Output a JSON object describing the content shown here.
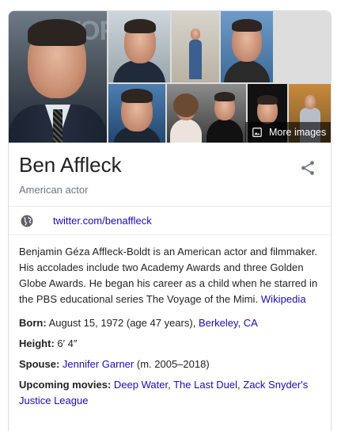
{
  "gallery": {
    "background_text": "TOR",
    "more_images_label": "More images",
    "more_images_icon": "image-icon"
  },
  "entity": {
    "name": "Ben Affleck",
    "subtitle": "American actor",
    "share_icon": "share-icon"
  },
  "website": {
    "icon": "globe-icon",
    "label": "twitter.com/benaffleck"
  },
  "description": {
    "text": "Benjamin Géza Affleck-Boldt is an American actor and filmmaker. His accolades include two Academy Awards and three Golden Globe Awards. He began his career as a child when he starred in the PBS educational series The Voyage of the Mimi.",
    "source_link": "Wikipedia"
  },
  "facts": {
    "born": {
      "label": "Born:",
      "value": "August 15, 1972 (age 47 years),",
      "link": "Berkeley, CA"
    },
    "height": {
      "label": "Height:",
      "value": "6′ 4″"
    },
    "spouse": {
      "label": "Spouse:",
      "link": "Jennifer Garner",
      "value": "(m. 2005–2018)"
    },
    "upcoming_movies": {
      "label": "Upcoming movies:",
      "link1": "Deep Water",
      "link2": "The Last Duel",
      "link3": "Zack Snyder's Justice League"
    }
  },
  "colors": {
    "link": "#1a0dab",
    "text": "#222222",
    "muted": "#70757a",
    "border": "#dadce0"
  }
}
